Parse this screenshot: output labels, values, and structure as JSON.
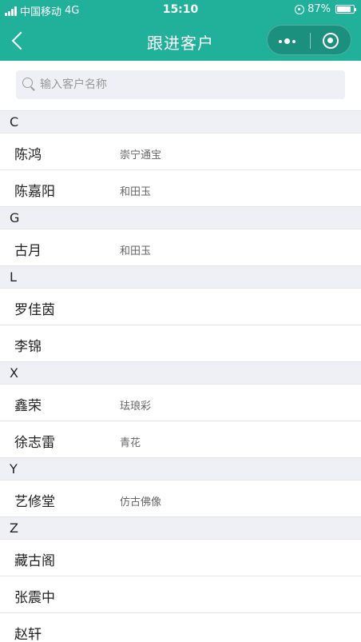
{
  "status_bar": {
    "carrier": "中国移动",
    "network": "4G",
    "time": "15:10",
    "battery_percent": "87%",
    "battery_level": 0.87
  },
  "nav": {
    "title": "跟进客户"
  },
  "search": {
    "placeholder": "输入客户名称",
    "value": ""
  },
  "groups": [
    {
      "letter": "C",
      "customers": [
        {
          "name": "陈鸿",
          "tag": "崇宁通宝"
        },
        {
          "name": "陈嘉阳",
          "tag": "和田玉"
        }
      ]
    },
    {
      "letter": "G",
      "customers": [
        {
          "name": "古月",
          "tag": "和田玉"
        }
      ]
    },
    {
      "letter": "L",
      "customers": [
        {
          "name": "罗佳茵",
          "tag": ""
        },
        {
          "name": "李锦",
          "tag": ""
        }
      ]
    },
    {
      "letter": "X",
      "customers": [
        {
          "name": "鑫荣",
          "tag": "珐琅彩"
        },
        {
          "name": "徐志雷",
          "tag": "青花"
        }
      ]
    },
    {
      "letter": "Y",
      "customers": [
        {
          "name": "艺修堂",
          "tag": "仿古佛像"
        }
      ]
    },
    {
      "letter": "Z",
      "customers": [
        {
          "name": "藏古阁",
          "tag": ""
        },
        {
          "name": "张震中",
          "tag": ""
        },
        {
          "name": "赵轩",
          "tag": ""
        }
      ]
    }
  ],
  "colors": {
    "brand": "#21b09a",
    "group_bg": "#eef0f5"
  }
}
